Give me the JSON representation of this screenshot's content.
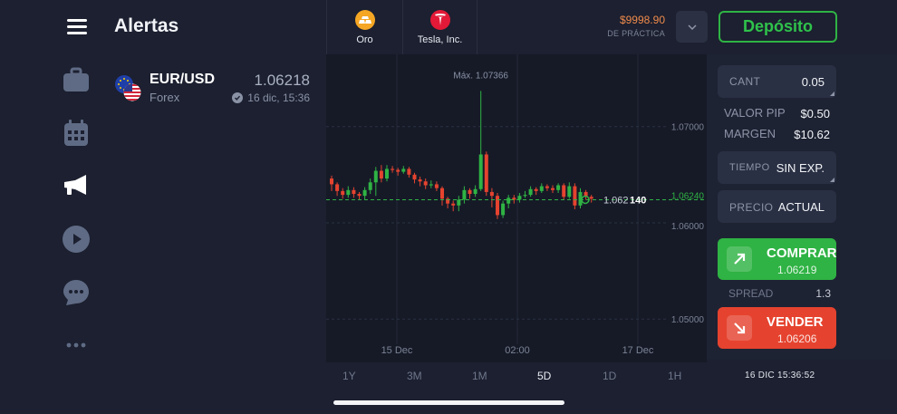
{
  "nav": {
    "icons": [
      "menu-icon",
      "briefcase-icon",
      "calendar-icon",
      "megaphone-icon",
      "play-icon",
      "chat-icon",
      "more-icon"
    ]
  },
  "alerts": {
    "title": "Alertas",
    "items": [
      {
        "pair": "EUR/USD",
        "category": "Forex",
        "price": "1.06218",
        "date": "16 dic, 15:36"
      }
    ]
  },
  "topbar": {
    "assets": [
      {
        "label": "Oro",
        "icon": "gold-icon",
        "color": "#f5a623"
      },
      {
        "label": "Tesla, Inc.",
        "icon": "tesla-icon",
        "color": "#e31937"
      }
    ],
    "balance": "$9998.90",
    "account_mode": "DE PRÁCTICA",
    "deposit_label": "Depósito"
  },
  "chart_data": {
    "type": "candlestick",
    "x_ticks": [
      "15 Dec",
      "02:00",
      "17 Dec"
    ],
    "y_ticks": [
      "1.07000",
      "1.06240",
      "1.06000",
      "1.05000"
    ],
    "ylim": [
      1.0455,
      1.0775
    ],
    "max_label": "Máx. 1.07366",
    "current_price_prefix": "1.062",
    "current_price_suffix": "140",
    "grid": true,
    "candles": [
      [
        1.0646,
        1.064,
        1.0649,
        1.0633
      ],
      [
        1.064,
        1.0633,
        1.0642,
        1.0628
      ],
      [
        1.0633,
        1.0629,
        1.0636,
        1.0625
      ],
      [
        1.0629,
        1.0634,
        1.0638,
        1.0626
      ],
      [
        1.0634,
        1.063,
        1.0637,
        1.0626
      ],
      [
        1.063,
        1.0628,
        1.0632,
        1.0624
      ],
      [
        1.0628,
        1.0634,
        1.0637,
        1.0624
      ],
      [
        1.0634,
        1.0642,
        1.0646,
        1.063
      ],
      [
        1.0642,
        1.0654,
        1.0658,
        1.0628
      ],
      [
        1.0654,
        1.0646,
        1.066,
        1.0642
      ],
      [
        1.0646,
        1.0656,
        1.066,
        1.0643
      ],
      [
        1.0656,
        1.0655,
        1.0659,
        1.0652
      ],
      [
        1.0655,
        1.0653,
        1.0657,
        1.0649
      ],
      [
        1.0653,
        1.0656,
        1.0659,
        1.0651
      ],
      [
        1.0656,
        1.065,
        1.0658,
        1.0647
      ],
      [
        1.065,
        1.0645,
        1.0652,
        1.0641
      ],
      [
        1.0645,
        1.0643,
        1.0648,
        1.0638
      ],
      [
        1.0643,
        1.0639,
        1.0646,
        1.0635
      ],
      [
        1.0639,
        1.064,
        1.0644,
        1.0636
      ],
      [
        1.064,
        1.0636,
        1.0643,
        1.0633
      ],
      [
        1.0636,
        1.0625,
        1.0638,
        1.0618
      ],
      [
        1.0625,
        1.062,
        1.0627,
        1.0615
      ],
      [
        1.062,
        1.0618,
        1.0623,
        1.0612
      ],
      [
        1.0618,
        1.0624,
        1.0628,
        1.0612
      ],
      [
        1.0624,
        1.0634,
        1.0638,
        1.062
      ],
      [
        1.0634,
        1.063,
        1.0636,
        1.0625
      ],
      [
        1.063,
        1.0635,
        1.0639,
        1.0627
      ],
      [
        1.0635,
        1.0671,
        1.0737,
        1.0633
      ],
      [
        1.0671,
        1.0632,
        1.0674,
        1.0628
      ],
      [
        1.0632,
        1.0628,
        1.0636,
        1.0616
      ],
      [
        1.0628,
        1.0608,
        1.0631,
        1.0604
      ],
      [
        1.0608,
        1.062,
        1.0623,
        1.0605
      ],
      [
        1.062,
        1.0626,
        1.0629,
        1.0615
      ],
      [
        1.0626,
        1.0624,
        1.0629,
        1.062
      ],
      [
        1.0624,
        1.0628,
        1.0631,
        1.0621
      ],
      [
        1.0628,
        1.0629,
        1.0633,
        1.0626
      ],
      [
        1.0629,
        1.0635,
        1.0638,
        1.0627
      ],
      [
        1.0635,
        1.0633,
        1.0637,
        1.0629
      ],
      [
        1.0633,
        1.0638,
        1.0641,
        1.0631
      ],
      [
        1.0638,
        1.0636,
        1.064,
        1.0633
      ],
      [
        1.0636,
        1.0634,
        1.0639,
        1.0631
      ],
      [
        1.0634,
        1.0639,
        1.0641,
        1.0631
      ],
      [
        1.0639,
        1.0627,
        1.0641,
        1.0624
      ],
      [
        1.0627,
        1.0638,
        1.0642,
        1.0625
      ],
      [
        1.0638,
        1.0618,
        1.0641,
        1.0614
      ],
      [
        1.0618,
        1.0632,
        1.0636,
        1.0615
      ],
      [
        1.0632,
        1.0627,
        1.0634,
        1.0624
      ],
      [
        1.0627,
        1.0625,
        1.0629,
        1.0621
      ]
    ]
  },
  "timeframes": [
    "1Y",
    "3M",
    "1M",
    "5D",
    "1D",
    "1H"
  ],
  "active_timeframe": "5D",
  "clock": "16 DIC 15:36:52",
  "trade_panel": {
    "amount_label": "CANT",
    "amount_value": "0.05",
    "pip_label": "VALOR PIP",
    "pip_value": "$0.50",
    "margin_label": "MARGEN",
    "margin_value": "$10.62",
    "time_label": "TIEMPO",
    "time_value": "SIN EXP.",
    "price_label": "PRECIO",
    "price_value": "ACTUAL",
    "buy_label": "COMPRAR",
    "buy_price": "1.06219",
    "spread_label": "SPREAD",
    "spread_value": "1.3",
    "sell_label": "VENDER",
    "sell_price": "1.06206",
    "buy_color": "#2fb344",
    "sell_color": "#e5432f"
  }
}
